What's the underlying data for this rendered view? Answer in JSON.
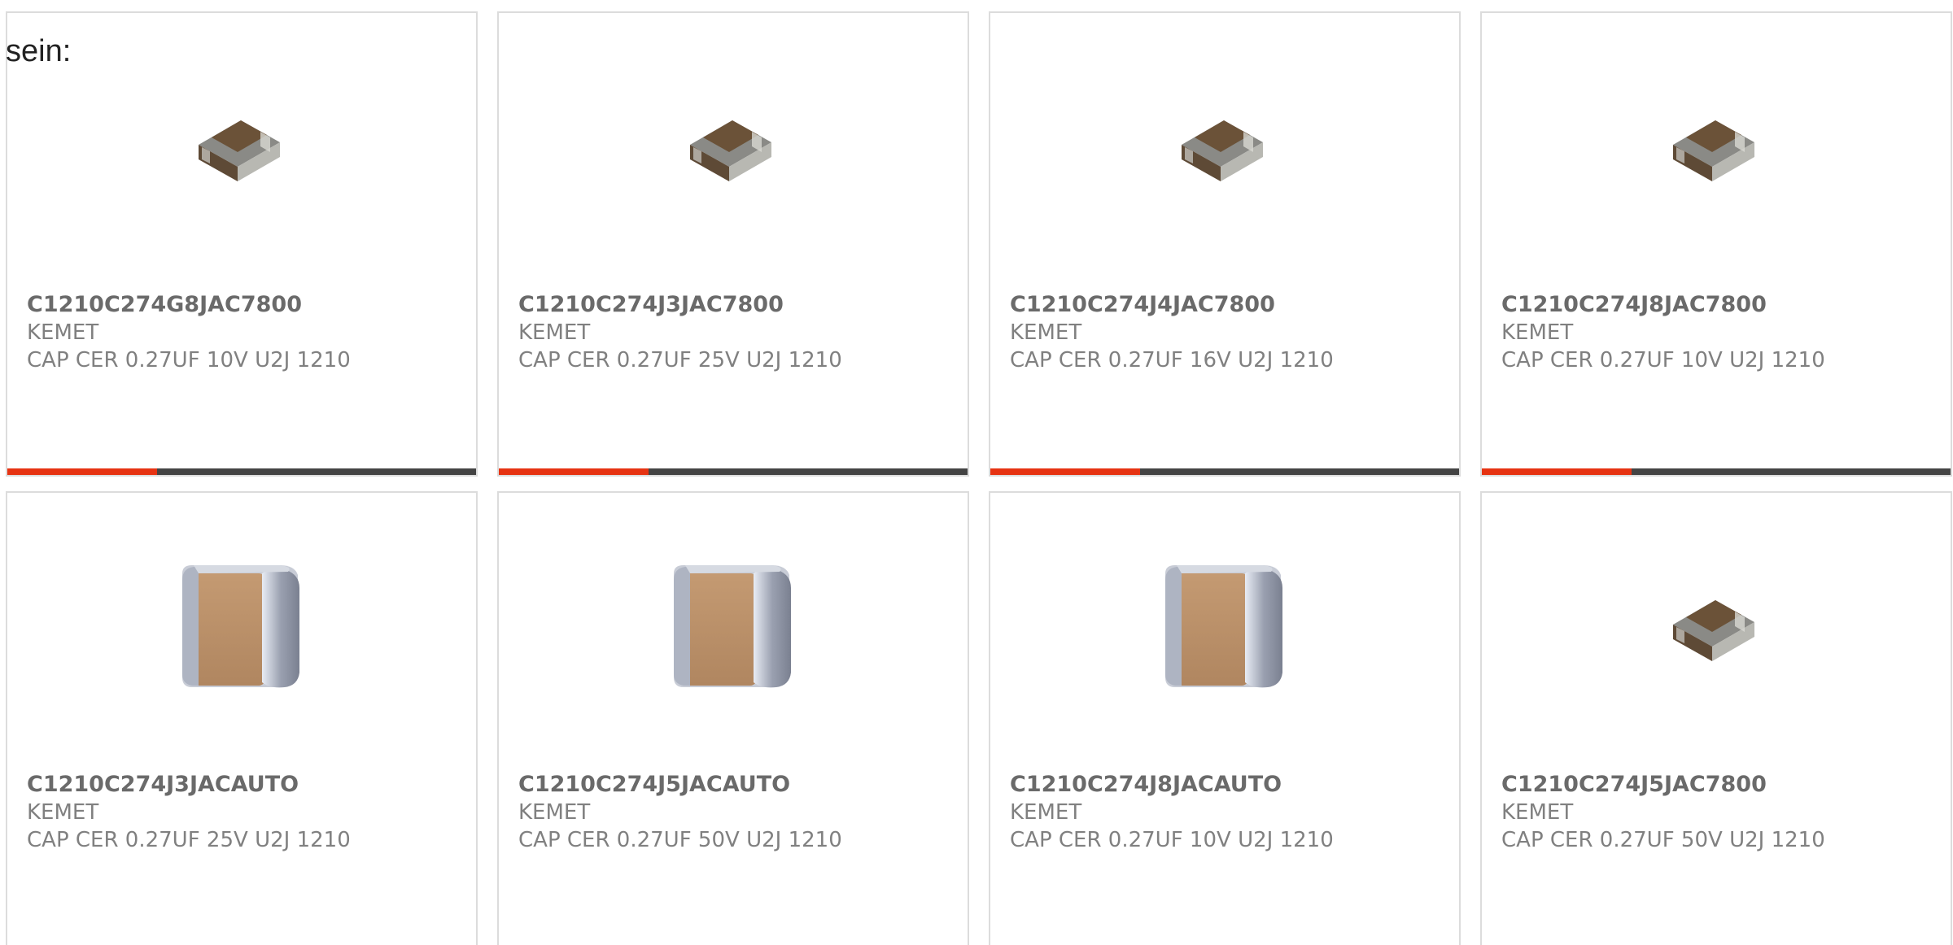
{
  "intro_text": "sein:",
  "colors": {
    "accent": "#e63312",
    "bar_track": "#444444",
    "card_border": "#dcdcdc",
    "part_number_text": "#6a6a6a",
    "secondary_text": "#808080"
  },
  "products": [
    {
      "part_number": "C1210C274G8JAC7800",
      "manufacturer": "KEMET",
      "description": "CAP CER 0.27UF 10V U2J 1210",
      "image_icon": "small-mlcc-chip-icon",
      "progress": 0.32
    },
    {
      "part_number": "C1210C274J3JAC7800",
      "manufacturer": "KEMET",
      "description": "CAP CER 0.27UF 25V U2J 1210",
      "image_icon": "small-mlcc-chip-icon",
      "progress": 0.32
    },
    {
      "part_number": "C1210C274J4JAC7800",
      "manufacturer": "KEMET",
      "description": "CAP CER 0.27UF 16V U2J 1210",
      "image_icon": "small-mlcc-chip-icon",
      "progress": 0.32
    },
    {
      "part_number": "C1210C274J8JAC7800",
      "manufacturer": "KEMET",
      "description": "CAP CER 0.27UF 10V U2J 1210",
      "image_icon": "small-mlcc-chip-icon",
      "progress": 0.32
    },
    {
      "part_number": "C1210C274J3JACAUTO",
      "manufacturer": "KEMET",
      "description": "CAP CER 0.27UF 25V U2J 1210",
      "image_icon": "large-mlcc-chip-icon",
      "progress": null
    },
    {
      "part_number": "C1210C274J5JACAUTO",
      "manufacturer": "KEMET",
      "description": "CAP CER 0.27UF 50V U2J 1210",
      "image_icon": "large-mlcc-chip-icon",
      "progress": null
    },
    {
      "part_number": "C1210C274J8JACAUTO",
      "manufacturer": "KEMET",
      "description": "CAP CER 0.27UF 10V U2J 1210",
      "image_icon": "large-mlcc-chip-icon",
      "progress": null
    },
    {
      "part_number": "C1210C274J5JAC7800",
      "manufacturer": "KEMET",
      "description": "CAP CER 0.27UF 50V U2J 1210",
      "image_icon": "small-mlcc-chip-icon",
      "progress": null
    }
  ]
}
